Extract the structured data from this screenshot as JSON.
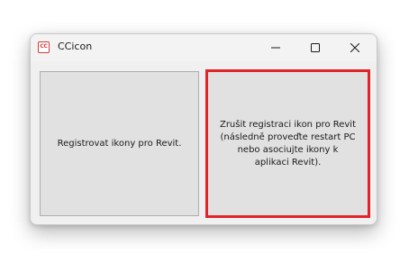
{
  "window": {
    "title": "CCicon",
    "icon_text": "CC",
    "icon_name": "ccicon-app-icon"
  },
  "caption": {
    "minimize_icon": "minimize-icon",
    "maximize_icon": "maximize-icon",
    "close_icon": "close-icon"
  },
  "buttons": {
    "register_label": "Registrovat ikony pro Revit.",
    "unregister_label": "Zrušit registraci ikon pro Revit (následně proveďte restart PC nebo asociujte ikony k aplikaci Revit)."
  },
  "colors": {
    "highlight_border": "#e0242a",
    "button_face": "#e1e1e1",
    "window_bg": "#f0f0f0"
  }
}
